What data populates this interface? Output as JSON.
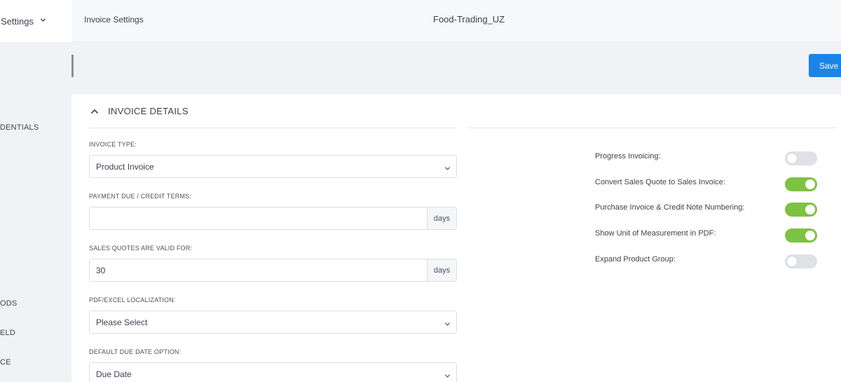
{
  "header": {
    "menu_label": "Settings",
    "breadcrumb": "Invoice Settings",
    "company": "Food-Trading_UZ"
  },
  "sidebar": {
    "items": [
      {
        "label": "DENTIALS"
      },
      {
        "label": "ODS"
      },
      {
        "label": "ELD"
      },
      {
        "label": "CE"
      }
    ]
  },
  "toolbar": {
    "save_label": "Save"
  },
  "section": {
    "title": "INVOICE DETAILS"
  },
  "fields": {
    "invoice_type": {
      "label": "INVOICE TYPE:",
      "value": "Product Invoice"
    },
    "payment_due": {
      "label": "PAYMENT DUE / CREDIT TERMS:",
      "value": "",
      "unit": "days"
    },
    "quotes_valid": {
      "label": "SALES QUOTES ARE VALID FOR:",
      "value": "30",
      "unit": "days"
    },
    "localization": {
      "label": "PDF/EXCEL LOCALIZATION:",
      "value": "Please Select"
    },
    "due_date_option": {
      "label": "DEFAULT DUE DATE OPTION:",
      "value": "Due Date"
    }
  },
  "toggles": [
    {
      "label": "Progress Invoicing:",
      "on": false
    },
    {
      "label": "Convert Sales Quote to Sales Invoice:",
      "on": true
    },
    {
      "label": "Purchase Invoice & Credit Note Numbering:",
      "on": true
    },
    {
      "label": "Show Unit of Measurement in PDF:",
      "on": true
    },
    {
      "label": "Expand Product Group:",
      "on": false
    }
  ],
  "colors": {
    "accent": "#1a85e6",
    "toggle_on": "#7dc242",
    "toggle_off": "#dfe1e5"
  }
}
